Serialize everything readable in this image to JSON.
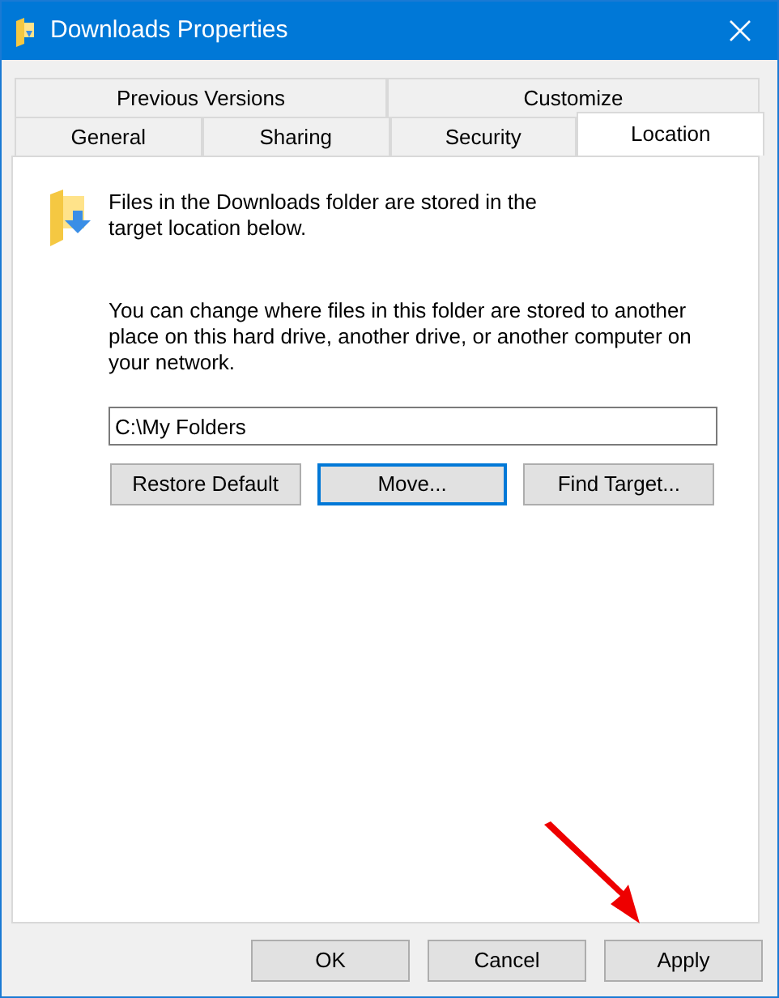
{
  "window": {
    "title": "Downloads Properties"
  },
  "tab_rows": [
    [
      {
        "label": "Previous Versions",
        "selected": false
      },
      {
        "label": "Customize",
        "selected": false
      }
    ],
    [
      {
        "label": "General",
        "selected": false
      },
      {
        "label": "Sharing",
        "selected": false
      },
      {
        "label": "Security",
        "selected": false
      },
      {
        "label": "Location",
        "selected": true
      }
    ]
  ],
  "panel": {
    "intro": "Files in the Downloads folder are stored in the target location below.",
    "description": "You can change where files in this folder are stored to another place on this hard drive, another drive, or another computer on your network.",
    "path": "C:\\My Folders",
    "buttons": [
      {
        "label": "Restore Default",
        "focused": false
      },
      {
        "label": "Move...",
        "focused": true
      },
      {
        "label": "Find Target...",
        "focused": false
      }
    ]
  },
  "footer_buttons": [
    "OK",
    "Cancel",
    "Apply"
  ]
}
